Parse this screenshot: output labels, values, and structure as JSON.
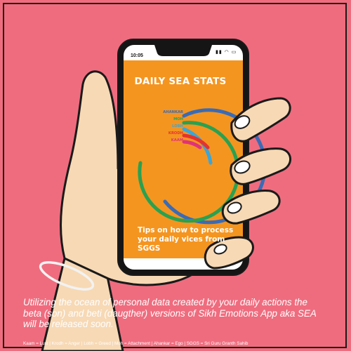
{
  "page": {
    "background_color": "#ef6c7e",
    "screen_color": "#f49520"
  },
  "phone": {
    "status_time": "10:05",
    "status_icons": "signal-icon wifi-icon battery-icon"
  },
  "app": {
    "title": "DAILY SEA STATS",
    "vices": [
      {
        "label": "AHANKAR",
        "color": "#3a6bb5"
      },
      {
        "label": "MOH",
        "color": "#2aa150"
      },
      {
        "label": "LOBH",
        "color": "#3aa6d8"
      },
      {
        "label": "KRODH",
        "color": "#e5322d"
      },
      {
        "label": "KAAM",
        "color": "#e0327a"
      }
    ],
    "tips_lines": [
      "Tips on how to process",
      "your daily vices from",
      "SGGS"
    ]
  },
  "caption_lines": [
    "Utilizing the ocean of personal data created by your daily actions the",
    "beta (son) and beti (daugther) versions of Sikh Emotions App aka SEA",
    "will be released soon."
  ],
  "legend": "Kaam = Lust | Krodh = Anger | Lobh = Greed | Moh = Attachment | Ahankar = Ego | SGGS = Sri Guru Granth Sahib"
}
